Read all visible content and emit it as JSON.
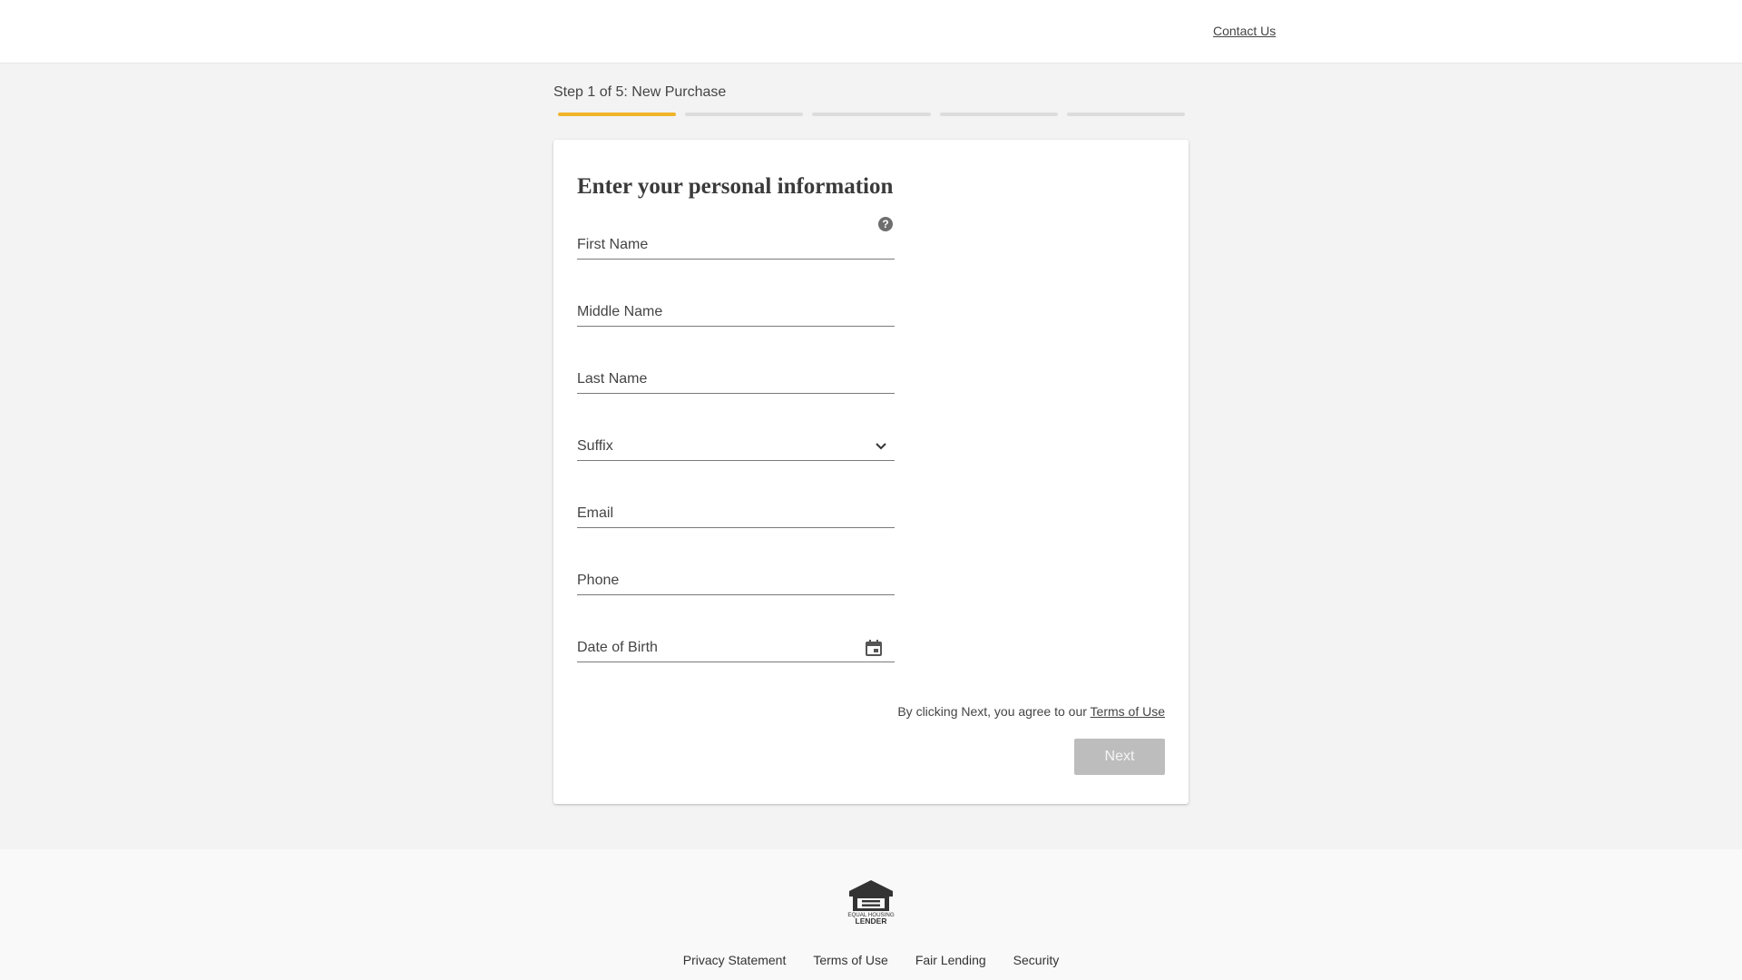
{
  "header": {
    "contact_label": "Contact Us"
  },
  "progress": {
    "step_label": "Step 1 of 5: New Purchase",
    "current_step": 1,
    "total_steps": 5,
    "active_color": "#f0b429",
    "inactive_color": "#dcdcdc"
  },
  "form": {
    "title": "Enter your personal information",
    "help_icon": "question-circle-icon",
    "fields": {
      "first_name": {
        "label": "First Name",
        "value": ""
      },
      "middle_name": {
        "label": "Middle Name",
        "value": ""
      },
      "last_name": {
        "label": "Last Name",
        "value": ""
      },
      "suffix": {
        "label": "Suffix",
        "value": "",
        "icon": "chevron-down-icon"
      },
      "email": {
        "label": "Email",
        "value": ""
      },
      "phone": {
        "label": "Phone",
        "value": ""
      },
      "dob": {
        "label": "Date of Birth",
        "value": "",
        "icon": "calendar-icon"
      }
    },
    "terms_prefix": "By clicking Next, you agree to our",
    "terms_link": "Terms of Use",
    "next_label": "Next",
    "next_disabled": true
  },
  "footer": {
    "logo_icon": "equal-housing-lender-icon",
    "logo_text_top": "EQUAL HOUSING",
    "logo_text_bottom": "LENDER",
    "links": {
      "privacy": "Privacy Statement",
      "terms": "Terms of Use",
      "fair_lending": "Fair Lending",
      "security": "Security"
    }
  }
}
